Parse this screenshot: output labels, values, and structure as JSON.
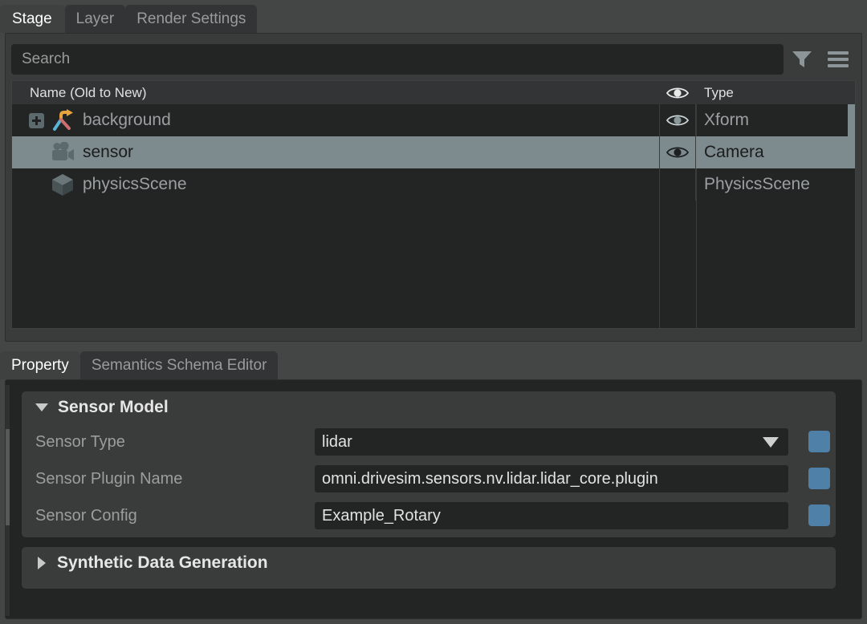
{
  "stage_panel": {
    "tabs": [
      {
        "label": "Stage",
        "active": true
      },
      {
        "label": "Layer",
        "active": false
      },
      {
        "label": "Render Settings",
        "active": false
      }
    ],
    "search": {
      "placeholder": "Search",
      "value": ""
    },
    "toolbar": {
      "filter_icon": "funnel-icon",
      "menu_icon": "hamburger-menu-icon"
    },
    "tree": {
      "columns": {
        "name": "Name (Old to New)",
        "visibility": "eye-icon",
        "type": "Type"
      },
      "rows": [
        {
          "name": "background",
          "type": "Xform",
          "icon": "xform-axis-icon",
          "expandable": true,
          "indented": false,
          "visible": true,
          "selected": false
        },
        {
          "name": "sensor",
          "type": "Camera",
          "icon": "camera-icon",
          "expandable": false,
          "indented": true,
          "visible": true,
          "selected": true
        },
        {
          "name": "physicsScene",
          "type": "PhysicsScene",
          "icon": "cube-icon",
          "expandable": false,
          "indented": true,
          "visible": false,
          "selected": false
        }
      ]
    }
  },
  "property_panel": {
    "tabs": [
      {
        "label": "Property",
        "active": true
      },
      {
        "label": "Semantics Schema Editor",
        "active": false
      }
    ],
    "groups": [
      {
        "title": "Sensor Model",
        "expanded": true,
        "rows": [
          {
            "label": "Sensor Type",
            "value": "lidar",
            "widget": "dropdown",
            "has_connector": true
          },
          {
            "label": "Sensor Plugin Name",
            "value": "omni.drivesim.sensors.nv.lidar.lidar_core.plugin",
            "widget": "text",
            "has_connector": true
          },
          {
            "label": "Sensor Config",
            "value": "Example_Rotary",
            "widget": "text",
            "has_connector": true
          }
        ]
      },
      {
        "title": "Synthetic Data Generation",
        "expanded": false,
        "rows": []
      }
    ]
  },
  "colors": {
    "window_bg": "#444545",
    "panel_bg": "#3a3b3b",
    "field_bg": "#232424",
    "tab_active": "#3f4040",
    "tab_inactive": "#333435",
    "selection": "#7d8a8e",
    "connector_blue": "#4e80a8",
    "text_primary": "#e6e6e6",
    "text_secondary": "#9d9d9d",
    "icon_grey": "#8c9699"
  }
}
